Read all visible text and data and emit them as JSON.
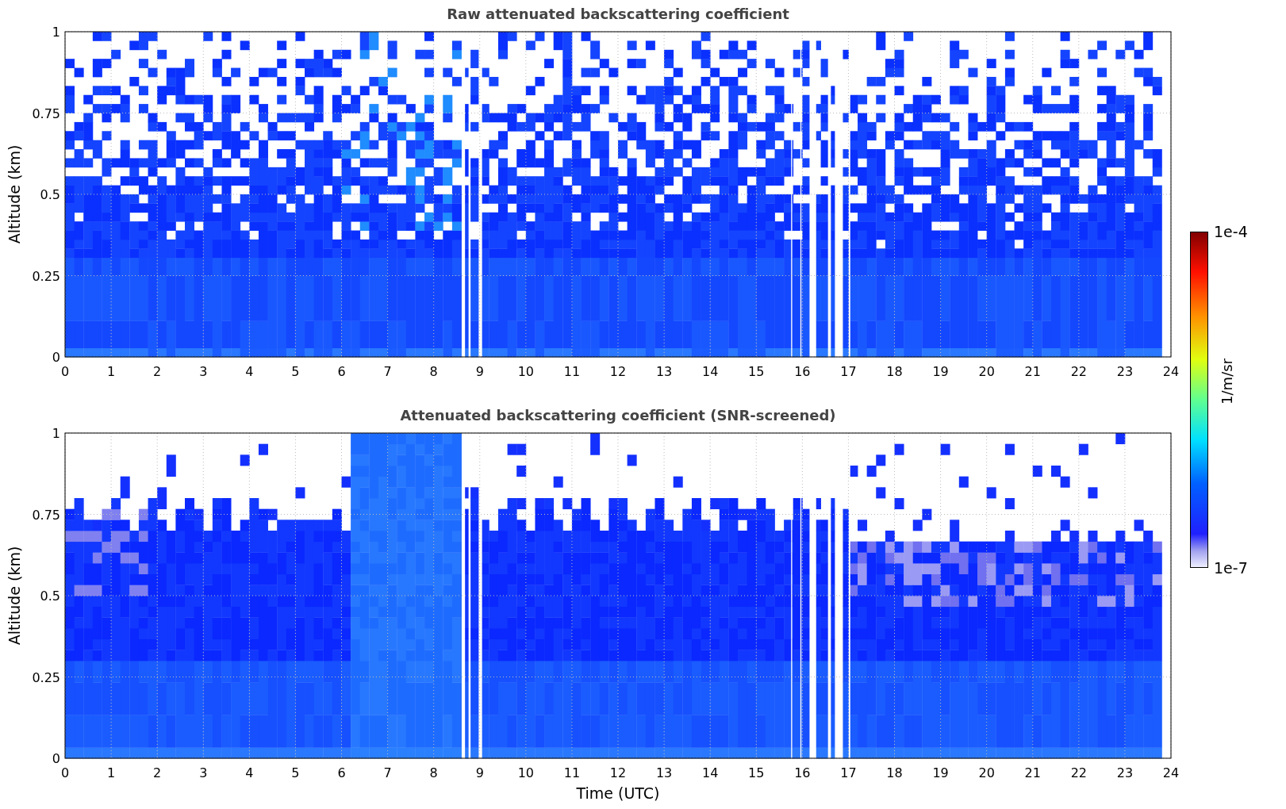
{
  "plots": [
    {
      "kind": "raw",
      "title": "Raw attenuated backscattering coefficient",
      "ylabel": "Altitude (km)",
      "yticks": [
        "1",
        "0.75",
        "0.5",
        "0.25",
        "0"
      ],
      "xticks": [
        "0",
        "1",
        "2",
        "3",
        "4",
        "5",
        "6",
        "7",
        "8",
        "9",
        "10",
        "11",
        "12",
        "13",
        "14",
        "15",
        "16",
        "17",
        "18",
        "19",
        "20",
        "21",
        "22",
        "23",
        "24"
      ]
    },
    {
      "kind": "screened",
      "title": "Attenuated backscattering coefficient (SNR-screened)",
      "ylabel": "Altitude (km)",
      "yticks": [
        "1",
        "0.75",
        "0.5",
        "0.25",
        "0"
      ],
      "xticks": [
        "0",
        "1",
        "2",
        "3",
        "4",
        "5",
        "6",
        "7",
        "8",
        "9",
        "10",
        "11",
        "12",
        "13",
        "14",
        "15",
        "16",
        "17",
        "18",
        "19",
        "20",
        "21",
        "22",
        "23",
        "24"
      ],
      "xlabel": "Time (UTC)"
    }
  ],
  "colorbar": {
    "max_label": "1e-4",
    "min_label": "1e-7",
    "label": "1/m/sr"
  }
}
